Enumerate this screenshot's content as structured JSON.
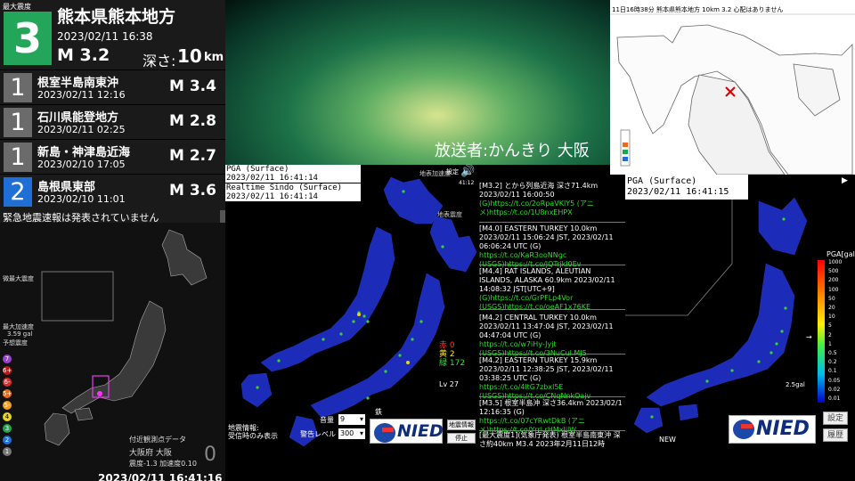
{
  "latest": {
    "max_label": "最大震度",
    "intensity": "3",
    "place": "熊本県熊本地方",
    "datetime": "2023/02/11  16:38",
    "magnitude": "M 3.2",
    "depth_label": "深さ:",
    "depth_value": "10",
    "depth_unit": "km"
  },
  "history": [
    {
      "intensity": "1",
      "place": "根室半島南東沖",
      "datetime": "2023/02/11  12:16",
      "magnitude": "M 3.4",
      "color": "#6b6b6b"
    },
    {
      "intensity": "1",
      "place": "石川県能登地方",
      "datetime": "2023/02/11  02:25",
      "magnitude": "M 2.8",
      "color": "#6b6b6b"
    },
    {
      "intensity": "1",
      "place": "新島・神津島近海",
      "datetime": "2023/02/10  17:05",
      "magnitude": "M 2.7",
      "color": "#6b6b6b"
    },
    {
      "intensity": "2",
      "place": "島根県東部",
      "datetime": "2023/02/10  11:01",
      "magnitude": "M 3.6",
      "color": "#1f6fd6"
    }
  ],
  "eew_note": "緊急地震速報は発表されていません",
  "mini_map": {
    "label_max_int": "微最大震度",
    "label_max_acc": "最大加速度",
    "max_acc_value": "3.59 gal",
    "label_forecast": "予想震度",
    "scale": [
      "7",
      "6+",
      "6-",
      "5+",
      "5-",
      "4",
      "3",
      "2",
      "1"
    ],
    "scale_colors": [
      "#9b3fd0",
      "#b81a1a",
      "#d92b2b",
      "#e86a1a",
      "#f0a01a",
      "#e8d41a",
      "#1aa84a",
      "#1f6fd6",
      "#777777"
    ],
    "station_title": "付近観測点データ",
    "station_name": "大阪府 大阪",
    "station_int_label": "震度",
    "station_int_value": "-1.3",
    "station_acc_label": "加速度",
    "station_acc_value": "0.10",
    "station_big": "0"
  },
  "left_clock": "2023/02/11 16:41:16",
  "broadcaster": "放送者:かんきり 大阪",
  "kyushu_map": {
    "header": "11日16時38分  熊本県熊本地方     10km    3.2    心配はありません"
  },
  "mid_panel": {
    "pga_title": "PGA (Surface)",
    "pga_time": "2023/02/11 16:41:14",
    "sindo_title": "Realtime Sindo (Surface)",
    "sindo_time": "2023/02/11 16:41:14",
    "map_tag_a": "地表加速度",
    "map_tag_b": "地表震度",
    "settings_label": "設定",
    "small_clock": "41:12",
    "count_red": "赤 0",
    "count_yellow": "黄 2",
    "count_green": "緑 172",
    "level": "Lv 27",
    "quake_info_label": "地震情報:",
    "receive_label": "受信時のみ表示",
    "volume_label": "音量",
    "volume_value": "9",
    "alert_label": "警告レベル",
    "alert_value": "300",
    "top_mark": "鉄",
    "quake_info_btn": "地震情報",
    "stop_btn": "停止",
    "nied": "NIED"
  },
  "news": [
    {
      "head": "[M3.2] とから列島近海 深さ71.4km",
      "body": "2023/02/11 16:00:50",
      "link": "(G)https://t.co/2oRpaVKlY5 (アニメ)https://t.co/1U8nxEHPX"
    },
    {
      "head": "[M4.0] EASTERN TURKEY 10.0km",
      "body": "2023/02/11 15:06:24 JST, 2023/02/11 06:06:24 UTC (G)",
      "link": "https://t.co/KaR3ooNNgc (USGS)https://t.co/JQTrjkl0Ev"
    },
    {
      "head": "[M4.4] RAT ISLANDS, ALEUTIAN ISLANDS, ALASKA 60.9km 2023/02/11",
      "body": "14:08:32 JST[UTC+9]",
      "link": "(G)https://t.co/GrPFLp4Vor (USGS)https://t.co/oeAF1x76KE"
    },
    {
      "head": "[M4.2] CENTRAL TURKEY 10.0km",
      "body": "2023/02/11 13:47:04 JST, 2023/02/11 04:47:04 UTC (G)",
      "link": "https://t.co/w7iHy-Jyjt (USGS)https://t.co/3NuCul.MJ5"
    },
    {
      "head": "[M4.2] EASTERN TURKEY 15.9km",
      "body": "2023/02/11 12:38:25 JST, 2023/02/11 03:38:25 UTC (G)",
      "link": "https://t.co/4ltG7zbxl5E (USGS)https://t.co/CNqNnkOajv"
    },
    {
      "head": "[M3.5] 根室半島沖 深さ36.4km 2023/02/1",
      "body": "12:16:35 (G)",
      "link": "https://t.co/07cYRwtDkB (アニメ)https://t.co/Yrrl rHMxlilW"
    },
    {
      "head": "[最大震度1](気象庁発表) 根室半島南東沖 深さ約40km M3.4 2023年2月11日12時",
      "body": "",
      "link": ""
    }
  ],
  "right_panel": {
    "pga_title": "PGA (Surface)",
    "pga_time": "2023/02/11 16:41:15",
    "scale_title": "PGA[gal]",
    "scale_values": [
      "1000",
      "500",
      "200",
      "100",
      "50",
      "20",
      "10",
      "5",
      "2",
      "1",
      "0.5",
      "0.2",
      "0.1",
      "0.05",
      "0.02",
      "0.01"
    ],
    "gal": "2.5gal",
    "new_label": "NEW",
    "settings_btn": "設定",
    "history_btn": "履歴",
    "nied": "NIED"
  }
}
